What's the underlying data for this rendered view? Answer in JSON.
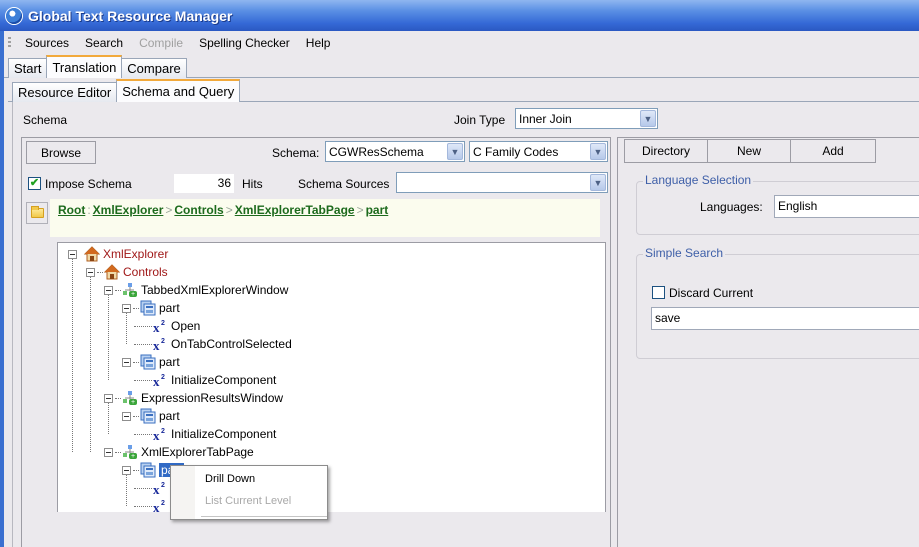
{
  "window": {
    "title": "Global Text Resource Manager"
  },
  "menu": [
    {
      "label": "Sources",
      "disabled": false
    },
    {
      "label": "Search",
      "disabled": false
    },
    {
      "label": "Compile",
      "disabled": true
    },
    {
      "label": "Spelling Checker",
      "disabled": false
    },
    {
      "label": "Help",
      "disabled": false
    }
  ],
  "main_tabs": [
    {
      "label": "Start",
      "active": false
    },
    {
      "label": "Translation",
      "active": true
    },
    {
      "label": "Compare",
      "active": false
    }
  ],
  "sub_tabs": [
    {
      "label": "Resource Editor",
      "active": false
    },
    {
      "label": "Schema and Query",
      "active": true
    }
  ],
  "schema_panel": {
    "title": "Schema",
    "join_type_label": "Join Type",
    "join_type_value": "Inner Join",
    "browse_label": "Browse",
    "schema_label": "Schema:",
    "schema_value": "CGWResSchema",
    "codes_value": "C Family Codes",
    "impose_schema_label": "Impose Schema",
    "impose_schema_checked": true,
    "hits_value": "36",
    "hits_label": "Hits",
    "schema_sources_label": "Schema Sources",
    "schema_sources_value": ""
  },
  "breadcrumb": {
    "root_label": "Root",
    "items": [
      "XmlExplorer",
      "Controls",
      "XmlExplorerTabPage",
      "part"
    ]
  },
  "tree": [
    {
      "label": "XmlExplorer",
      "icon": "house-icon",
      "level": 0,
      "expanded": true
    },
    {
      "label": "Controls",
      "icon": "house-icon",
      "level": 1,
      "expanded": true
    },
    {
      "label": "TabbedXmlExplorerWindow",
      "icon": "class-icon",
      "level": 2,
      "expanded": true
    },
    {
      "label": "part",
      "icon": "part-icon",
      "level": 3,
      "expanded": true
    },
    {
      "label": "Open",
      "icon": "method-icon",
      "level": 4
    },
    {
      "label": "OnTabControlSelected",
      "icon": "method-icon",
      "level": 4
    },
    {
      "label": "part",
      "icon": "part-icon",
      "level": 3,
      "expanded": true
    },
    {
      "label": "InitializeComponent",
      "icon": "method-icon",
      "level": 4
    },
    {
      "label": "ExpressionResultsWindow",
      "icon": "class-icon",
      "level": 2,
      "expanded": true
    },
    {
      "label": "part",
      "icon": "part-icon",
      "level": 3,
      "expanded": true
    },
    {
      "label": "InitializeComponent",
      "icon": "method-icon",
      "level": 4
    },
    {
      "label": "XmlExplorerTabPage",
      "icon": "class-icon",
      "level": 2,
      "expanded": true
    },
    {
      "label": "part",
      "icon": "part-icon",
      "level": 3,
      "expanded": true,
      "selected": true
    },
    {
      "label": "",
      "icon": "method-icon",
      "level": 4
    },
    {
      "label": "",
      "icon": "method-icon",
      "level": 4
    }
  ],
  "context_menu": [
    {
      "label": "Drill Down",
      "disabled": false
    },
    {
      "label": "List Current Level",
      "disabled": true
    }
  ],
  "right_panel": {
    "buttons": [
      "Directory",
      "New",
      "Add"
    ],
    "language_group_title": "Language Selection",
    "languages_label": "Languages:",
    "languages_value": "English",
    "search_group_title": "Simple Search",
    "discard_current_label": "Discard Current",
    "discard_current_checked": false,
    "search_value": "save"
  }
}
